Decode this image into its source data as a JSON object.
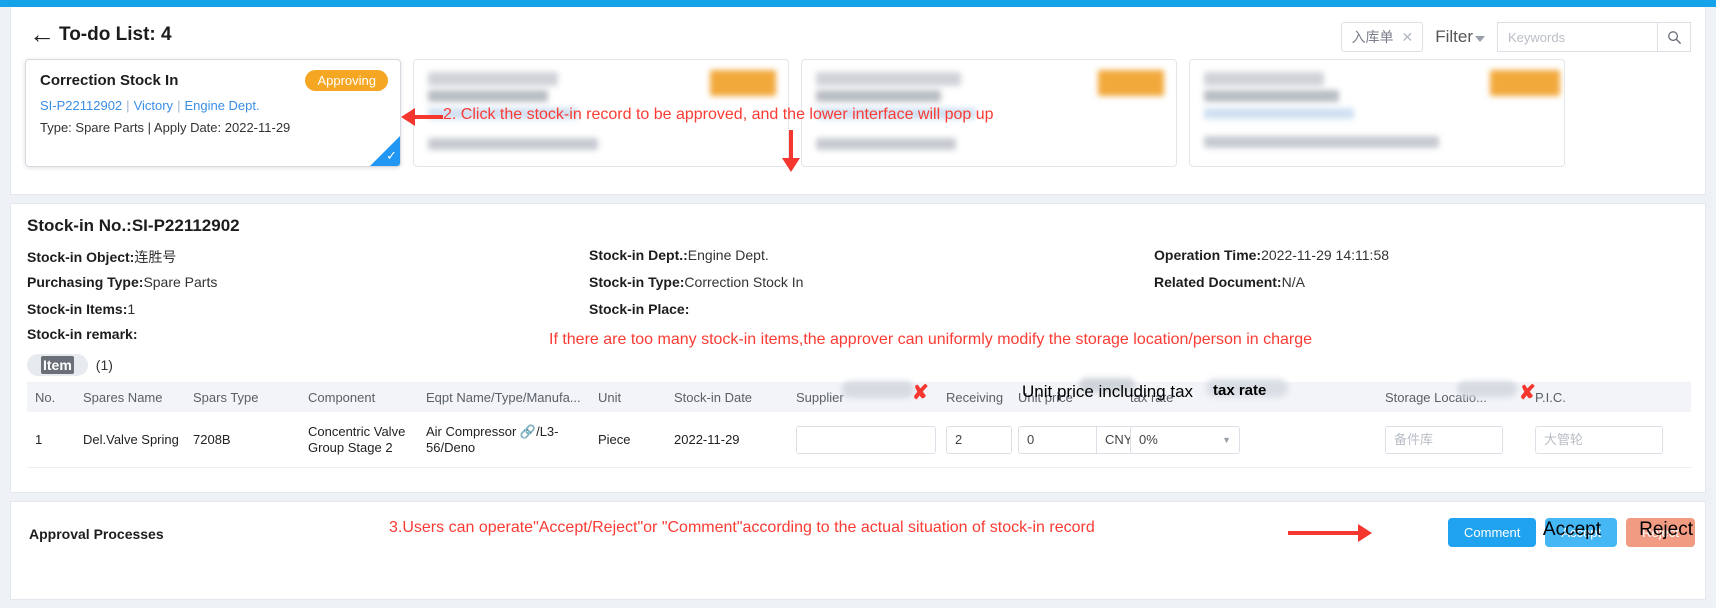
{
  "header": {
    "back_icon": "back-arrow-icon",
    "title": "To-do List: 4",
    "tag_chip": "入库单",
    "tag_close": "✕",
    "filter_label": "Filter",
    "search_placeholder": "Keywords",
    "search_value": "",
    "search_icon": "search-icon"
  },
  "cards": [
    {
      "title": "Correction Stock In",
      "badge": "Approving",
      "code": "SI-P22112902",
      "owner": "Victory",
      "dept": "Engine Dept.",
      "meta": "Type:  Spare Parts | Apply Date:  2022-11-29",
      "selected": true
    },
    {
      "title": "",
      "badge": "",
      "code": "",
      "owner": "",
      "dept": "",
      "meta": "",
      "selected": false
    },
    {
      "title": "",
      "badge": "",
      "code": "",
      "owner": "",
      "dept": "",
      "meta": "",
      "selected": false
    },
    {
      "title": "",
      "badge": "",
      "code": "",
      "owner": "",
      "dept": "",
      "meta": "",
      "selected": false
    }
  ],
  "detail": {
    "stock_in_no_label": "Stock-in No.:",
    "stock_in_no_value": "SI-P22112902",
    "fields": [
      {
        "label": "Stock-in Object:",
        "value": "连胜号"
      },
      {
        "label": "Purchasing Type:",
        "value": "Spare Parts"
      },
      {
        "label": "Stock-in Items:",
        "value": "1"
      },
      {
        "label": "Stock-in remark:",
        "value": ""
      },
      {
        "label": "Stock-in Dept.:",
        "value": "Engine Dept."
      },
      {
        "label": "Stock-in Type:",
        "value": "Correction Stock In"
      },
      {
        "label": "Stock-in Place:",
        "value": ""
      },
      {
        "label": "Operation Time:",
        "value": "2022-11-29 14:11:58"
      },
      {
        "label": "Related Document:",
        "value": "N/A"
      }
    ],
    "item_tab": "Item",
    "item_count": "(1)",
    "columns": [
      "No.",
      "Spares Name",
      "Spars Type",
      "Component",
      "Eqpt Name/Type/Manufa...",
      "Unit",
      "Stock-in Date",
      "Supplier",
      "Receiving",
      "Unit price",
      "tax rate",
      "Storage Locatio...",
      "P.I.C."
    ],
    "rows": [
      {
        "no": "1",
        "spares_name": "Del.Valve Spring",
        "spars_type": "7208B",
        "component": "Concentric Valve Group Stage 2",
        "eqpt": "Air Compressor 🔗/L3-56/Deno",
        "unit": "Piece",
        "date": "2022-11-29",
        "supplier": "",
        "supplier_placeholder": "",
        "receiving": "2",
        "price": "0",
        "currency": "CNY",
        "tax_rate": "0%",
        "storage_location": "备件库",
        "pic": "大管轮"
      }
    ]
  },
  "approval": {
    "title": "Approval Processes",
    "comment_label": "Comment",
    "accept_label": "Accept",
    "reject_label": "Reject"
  },
  "annotations": {
    "step2": "2. Click the stock-in record to be approved, and the lower interface will pop up",
    "tip_modify": "If there are too many stock-in items,the approver can uniformly modify the storage location/person in charge",
    "step3": "3.Users can operate\"Accept/Reject\"or \"Comment\"according to the actual situation of stock-in record",
    "overlay_unit_price": "Unit price including tax",
    "overlay_tax_rate": "tax rate"
  },
  "colors": {
    "accent": "#14a2e8",
    "badge": "#f5a623",
    "annotation": "#fb3b34",
    "accept": "#45b7f5",
    "reject": "#f29b83"
  }
}
